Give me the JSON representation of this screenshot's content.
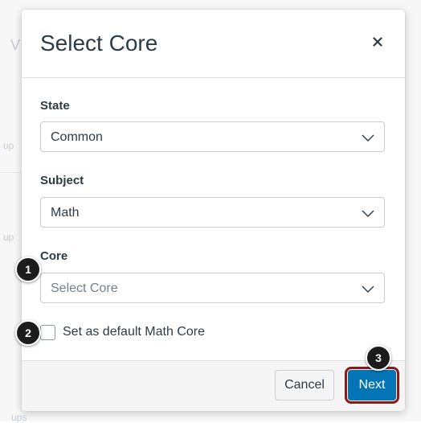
{
  "background": {
    "fragments": [
      "V",
      "up",
      "up",
      "ups"
    ]
  },
  "modal": {
    "title": "Select Core",
    "close_icon_glyph": "×",
    "fields": [
      {
        "label": "State",
        "value": "Common",
        "placeholder": ""
      },
      {
        "label": "Subject",
        "value": "Math",
        "placeholder": ""
      },
      {
        "label": "Core",
        "value": "",
        "placeholder": "Select Core"
      }
    ],
    "checkbox": {
      "label": "Set as default Math Core",
      "checked": false
    },
    "footer": {
      "cancel_label": "Cancel",
      "next_label": "Next"
    }
  },
  "callouts": [
    "1",
    "2",
    "3"
  ],
  "colors": {
    "primary_button": "#0374b5",
    "highlight_outline": "#8b1a1a",
    "text": "#2d3b45"
  }
}
